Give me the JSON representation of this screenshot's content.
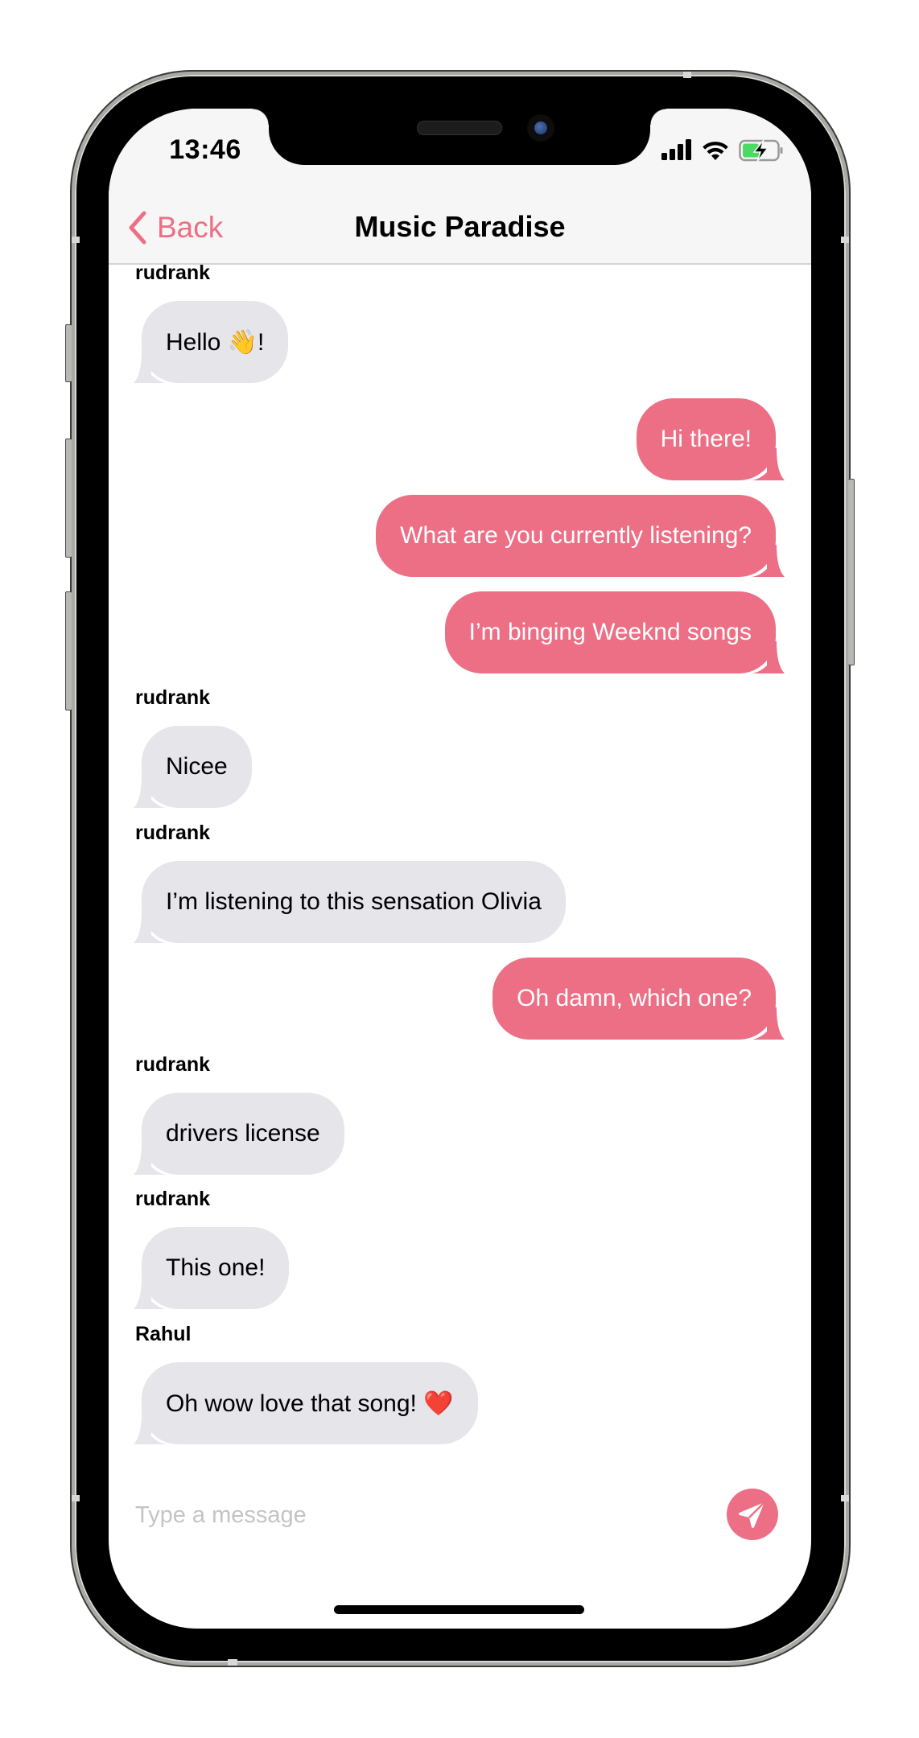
{
  "status_bar": {
    "time": "13:46",
    "icons": [
      "signal-icon",
      "wifi-icon",
      "battery-charging-icon"
    ]
  },
  "nav": {
    "back_label": "Back",
    "title": "Music Paradise",
    "accent_color": "#EC6F85"
  },
  "colors": {
    "outgoing_bubble": "#EC6F85",
    "incoming_bubble": "#E5E5EA",
    "nav_background": "#F6F6F6"
  },
  "messages": [
    {
      "sender": "rudrank",
      "direction": "incoming",
      "text": "Hello 👋!"
    },
    {
      "sender": "",
      "direction": "outgoing",
      "text": "Hi there!"
    },
    {
      "sender": "",
      "direction": "outgoing",
      "text": "What are you currently listening?"
    },
    {
      "sender": "",
      "direction": "outgoing",
      "text": "I’m binging Weeknd songs"
    },
    {
      "sender": "rudrank",
      "direction": "incoming",
      "text": "Nicee"
    },
    {
      "sender": "rudrank",
      "direction": "incoming",
      "text": "I’m listening to this sensation Olivia"
    },
    {
      "sender": "",
      "direction": "outgoing",
      "text": "Oh damn, which one?"
    },
    {
      "sender": "rudrank",
      "direction": "incoming",
      "text": "drivers license"
    },
    {
      "sender": "rudrank",
      "direction": "incoming",
      "text": "This one!"
    },
    {
      "sender": "Rahul",
      "direction": "incoming",
      "text": "Oh wow love that song! ❤️"
    }
  ],
  "composer": {
    "placeholder": "Type a message",
    "value": "",
    "send_icon": "paper-plane-icon"
  }
}
